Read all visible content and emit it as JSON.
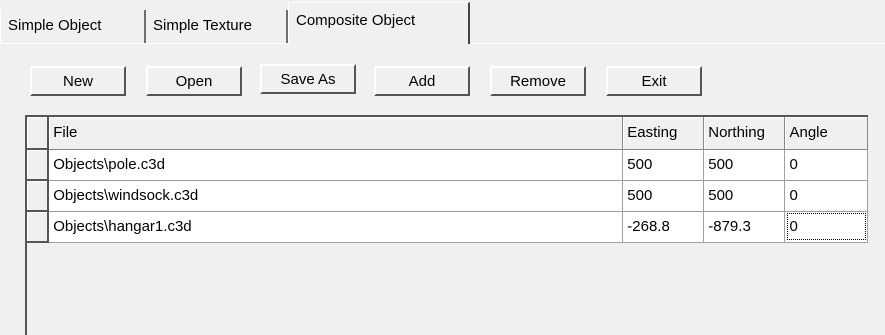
{
  "tabs": [
    {
      "label": "Simple Object",
      "active": false
    },
    {
      "label": "Simple Texture",
      "active": false
    },
    {
      "label": "Composite Object",
      "active": true
    }
  ],
  "toolbar": {
    "new_label": "New",
    "open_label": "Open",
    "save_as_label": "Save As",
    "add_label": "Add",
    "remove_label": "Remove",
    "exit_label": "Exit"
  },
  "grid": {
    "columns": [
      "File",
      "Easting",
      "Northing",
      "Angle"
    ],
    "rows": [
      {
        "file": "Objects\\pole.c3d",
        "easting": "500",
        "northing": "500",
        "angle": "0"
      },
      {
        "file": "Objects\\windsock.c3d",
        "easting": "500",
        "northing": "500",
        "angle": "0"
      },
      {
        "file": "Objects\\hangar1.c3d",
        "easting": "-268.8",
        "northing": "-879.3",
        "angle": "0"
      }
    ],
    "focused_cell": "rows.2.angle"
  },
  "colors": {
    "face": "#f0f0f0",
    "shadow": "#555555",
    "highlight": "#ffffff",
    "cell_background": "#ffffff"
  }
}
